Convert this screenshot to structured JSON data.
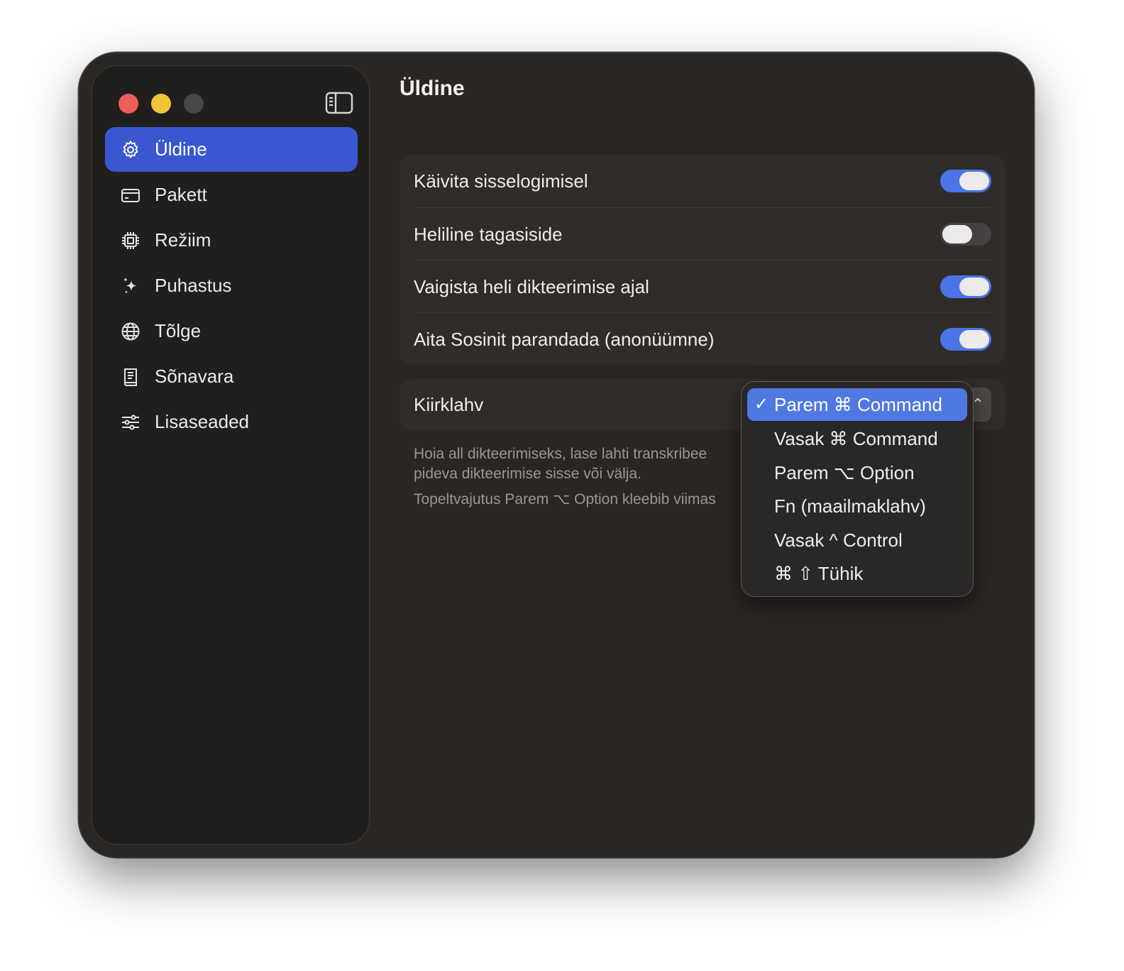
{
  "window": {
    "traffic_lights": [
      "close",
      "minimize",
      "zoom"
    ]
  },
  "sidebar": {
    "toggle_icon": "sidebar-toggle-icon",
    "items": [
      {
        "label": "Üldine",
        "icon": "gear-icon",
        "active": true
      },
      {
        "label": "Pakett",
        "icon": "credit-card-icon",
        "active": false
      },
      {
        "label": "Režiim",
        "icon": "chip-icon",
        "active": false
      },
      {
        "label": "Puhastus",
        "icon": "sparkles-icon",
        "active": false
      },
      {
        "label": "Tõlge",
        "icon": "globe-icon",
        "active": false
      },
      {
        "label": "Sõnavara",
        "icon": "book-icon",
        "active": false
      },
      {
        "label": "Lisaseaded",
        "icon": "sliders-icon",
        "active": false
      }
    ]
  },
  "main": {
    "title": "Üldine",
    "toggles": [
      {
        "label": "Käivita sisselogimisel",
        "on": true
      },
      {
        "label": "Heliline tagasiside",
        "on": false
      },
      {
        "label": "Vaigista heli dikteerimise ajal",
        "on": true
      },
      {
        "label": "Aita Sosinit parandada (anonüümne)",
        "on": true
      }
    ],
    "hotkey": {
      "label": "Kiirklahv",
      "popup_arrow": "⌃",
      "help_line1": "Hoia all dikteerimiseks, lase lahti transkribee",
      "help_line2": "pideva dikteerimise sisse või välja.",
      "help_line3": "Topeltvajutus Parem ⌥ Option kleebib viimas"
    }
  },
  "menu": {
    "check": "✓",
    "selected_index": 0,
    "options": [
      "Parem ⌘ Command",
      "Vasak ⌘ Command",
      "Parem ⌥ Option",
      "Fn (maailmaklahv)",
      "Vasak ^ Control",
      "⌘ ⇧ Tühik"
    ]
  },
  "colors": {
    "accent": "#3a57cf",
    "toggle_on": "#4a74e8",
    "menu_highlight": "#4f78e0",
    "window_bg": "#292624",
    "sidebar_bg": "#201f1d"
  }
}
